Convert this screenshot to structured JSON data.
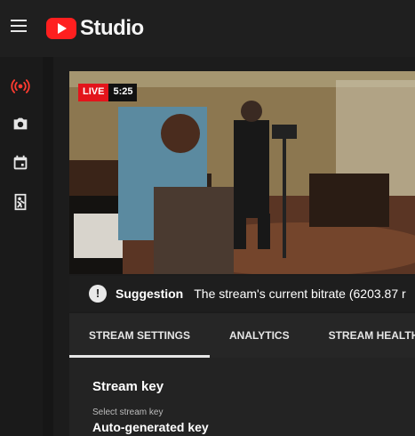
{
  "app": {
    "name": "Studio"
  },
  "sidebar": {
    "items": [
      {
        "icon": "live-broadcast-icon",
        "active_color": "#ff3b30"
      },
      {
        "icon": "camera-icon"
      },
      {
        "icon": "calendar-icon"
      },
      {
        "icon": "stream-import-icon"
      }
    ]
  },
  "preview": {
    "live_label": "LIVE",
    "time": "5:25"
  },
  "suggestion": {
    "label": "Suggestion",
    "message": "The stream's current bitrate (6203.87 r"
  },
  "tabs": [
    {
      "label": "STREAM SETTINGS",
      "active": true
    },
    {
      "label": "ANALYTICS"
    },
    {
      "label": "STREAM HEALTH"
    }
  ],
  "stream_settings": {
    "section_title": "Stream key",
    "field_label": "Select stream key",
    "field_value": "Auto-generated key"
  },
  "colors": {
    "brand": "#ff1f1f",
    "live_badge": "#e3141b"
  }
}
